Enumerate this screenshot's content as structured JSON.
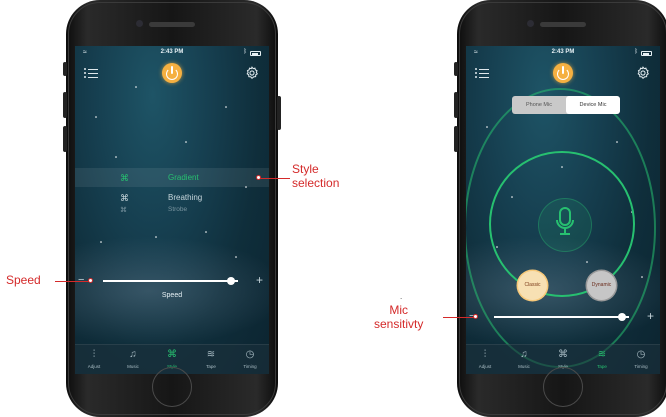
{
  "colors": {
    "accent_green": "#27c070",
    "power_orange": "#f5b041",
    "annotation_red": "#d42a2a"
  },
  "status_bar": {
    "time": "2:43 PM"
  },
  "icons": {
    "menu": "menu-list-icon",
    "power": "power-icon",
    "settings": "gear-icon",
    "microphone": "microphone-icon"
  },
  "phone1": {
    "styles": [
      {
        "label": "Gradient",
        "icon": "⌘",
        "selected": true
      },
      {
        "label": "Breathing",
        "icon": "⌘",
        "selected": false
      },
      {
        "label": "Strobe",
        "icon": "⌘",
        "selected": false
      }
    ],
    "speed_slider": {
      "minus": "−",
      "plus": "+",
      "value": 0.95
    },
    "speed_label": "Speed",
    "tabs": [
      {
        "label": "Adjust",
        "icon": "⫶",
        "active": false
      },
      {
        "label": "Music",
        "icon": "♫",
        "active": false
      },
      {
        "label": "Style",
        "icon": "⌘",
        "active": true
      },
      {
        "label": "Tape",
        "icon": "≋",
        "active": false
      },
      {
        "label": "Timing",
        "icon": "◷",
        "active": false
      }
    ]
  },
  "phone2": {
    "mic_toggle": {
      "left": "Phone Mic",
      "right": "Device Mic",
      "selected": "Device Mic"
    },
    "modes": {
      "classic": "Classic",
      "dynamic": "Dynamic"
    },
    "sensitivity_slider": {
      "minus": "−",
      "plus": "+",
      "value": 0.95
    },
    "tabs": [
      {
        "label": "Adjust",
        "icon": "⫶",
        "active": false
      },
      {
        "label": "Music",
        "icon": "♫",
        "active": false
      },
      {
        "label": "Style",
        "icon": "⌘",
        "active": false
      },
      {
        "label": "Tape",
        "icon": "≋",
        "active": true
      },
      {
        "label": "Timing",
        "icon": "◷",
        "active": false
      }
    ]
  },
  "annotations": {
    "style_selection_line1": "Style",
    "style_selection_line2": "selection",
    "speed": "Speed",
    "mic_line1": "Mic",
    "mic_line2": "sensitivty",
    "dot": "."
  }
}
